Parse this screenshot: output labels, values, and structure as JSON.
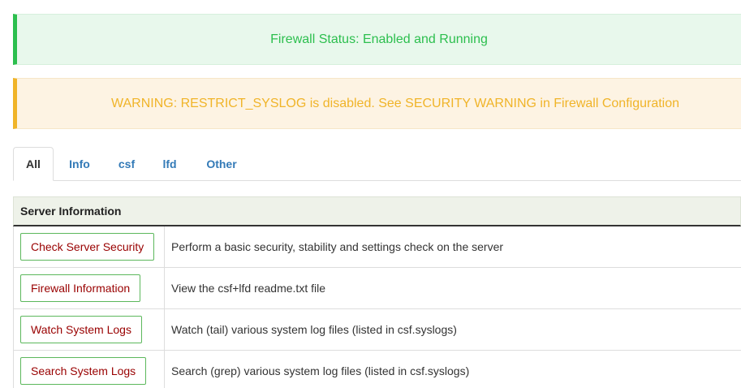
{
  "alerts": {
    "status": "Firewall Status: Enabled and Running",
    "warning": "WARNING: RESTRICT_SYSLOG is disabled. See SECURITY WARNING in Firewall Configuration"
  },
  "tabs": [
    {
      "label": "All",
      "active": true
    },
    {
      "label": "Info"
    },
    {
      "label": "csf"
    },
    {
      "label": "lfd"
    },
    {
      "label": "Other"
    }
  ],
  "section": {
    "title": "Server Information",
    "rows": [
      {
        "button": "Check Server Security",
        "desc": "Perform a basic security, stability and settings check on the server"
      },
      {
        "button": "Firewall Information",
        "desc": "View the csf+lfd readme.txt file"
      },
      {
        "button": "Watch System Logs",
        "desc": "Watch (tail) various system log files (listed in csf.syslogs)"
      },
      {
        "button": "Search System Logs",
        "desc": "Search (grep) various system log files (listed in csf.syslogs)"
      }
    ]
  },
  "colors": {
    "success": "#2cbf4e",
    "warning": "#f0b429",
    "link": "#337ab7",
    "button_text": "#990000",
    "button_border": "#5cb85c"
  }
}
